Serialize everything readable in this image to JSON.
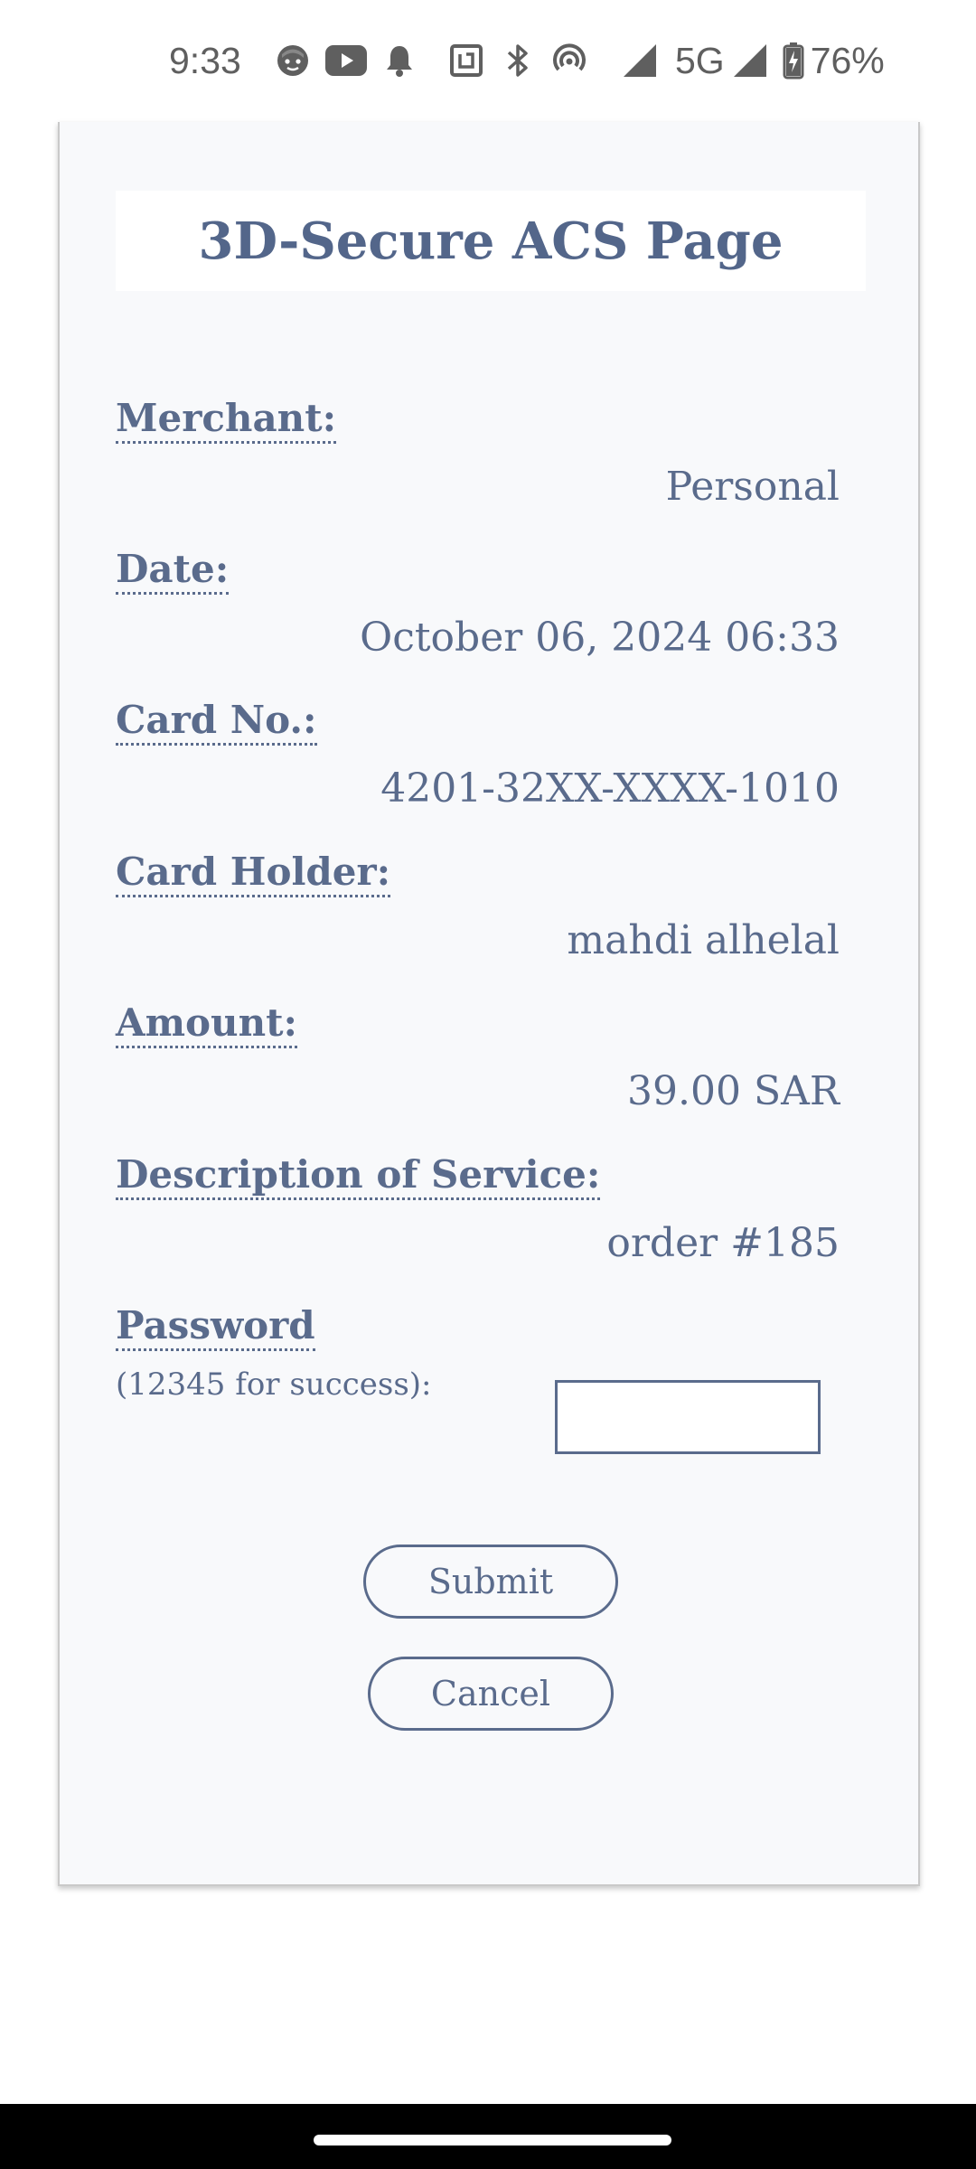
{
  "status_bar": {
    "time": "9:33",
    "network": "5G",
    "battery": "76%",
    "icons": [
      "face-icon",
      "youtube-icon",
      "notification-bell-icon",
      "nfc-icon",
      "bluetooth-icon",
      "hotspot-icon",
      "signal-icon",
      "signal-icon",
      "battery-charging-icon"
    ]
  },
  "page": {
    "title": "3D-Secure ACS Page",
    "fields": [
      {
        "label": "Merchant:",
        "value": "Personal"
      },
      {
        "label": "Date:",
        "value": "October 06, 2024 06:33"
      },
      {
        "label": "Card No.:",
        "value": "4201-32XX-XXXX-1010"
      },
      {
        "label": "Card Holder:",
        "value": "mahdi alhelal"
      },
      {
        "label": "Amount:",
        "value": "39.00 SAR"
      },
      {
        "label": "Description of Service:",
        "value": "order #185"
      }
    ],
    "password": {
      "label": "Password",
      "hint": "(12345 for success):",
      "value": ""
    },
    "buttons": {
      "submit": "Submit",
      "cancel": "Cancel"
    }
  },
  "colors": {
    "text": "#5a6b8c",
    "card_background": "#f8f9fb"
  }
}
